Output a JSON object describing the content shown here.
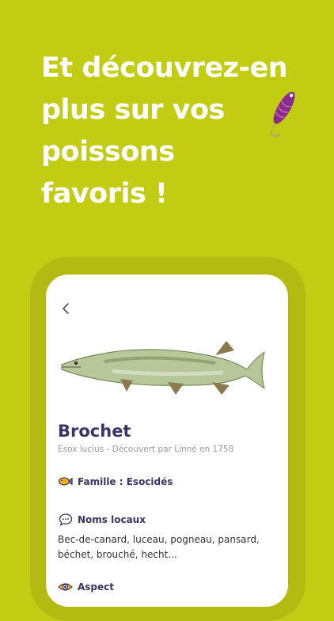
{
  "colors": {
    "background": "#c2cc12",
    "frame": "#b3bb12",
    "title": "#3a3566",
    "lure_body": "#8a2a8a"
  },
  "headline": {
    "lines": [
      "Et découvrez-en",
      "plus sur vos",
      "poissons",
      "favoris !"
    ]
  },
  "card": {
    "back_icon": "chevron-left-icon",
    "fish_name": "Brochet",
    "subtitle": "Esox lucius - Découvert par Linné en 1758",
    "family": {
      "icon": "fish-icon",
      "label": "Famille : Esocidés"
    },
    "local_names": {
      "icon": "chat-bubble-icon",
      "label": "Noms locaux",
      "text": "Bec-de-canard, luceau, pogneau, pansard, béchet, brouché, hecht..."
    },
    "aspect": {
      "icon": "eye-icon",
      "label": "Aspect"
    }
  }
}
